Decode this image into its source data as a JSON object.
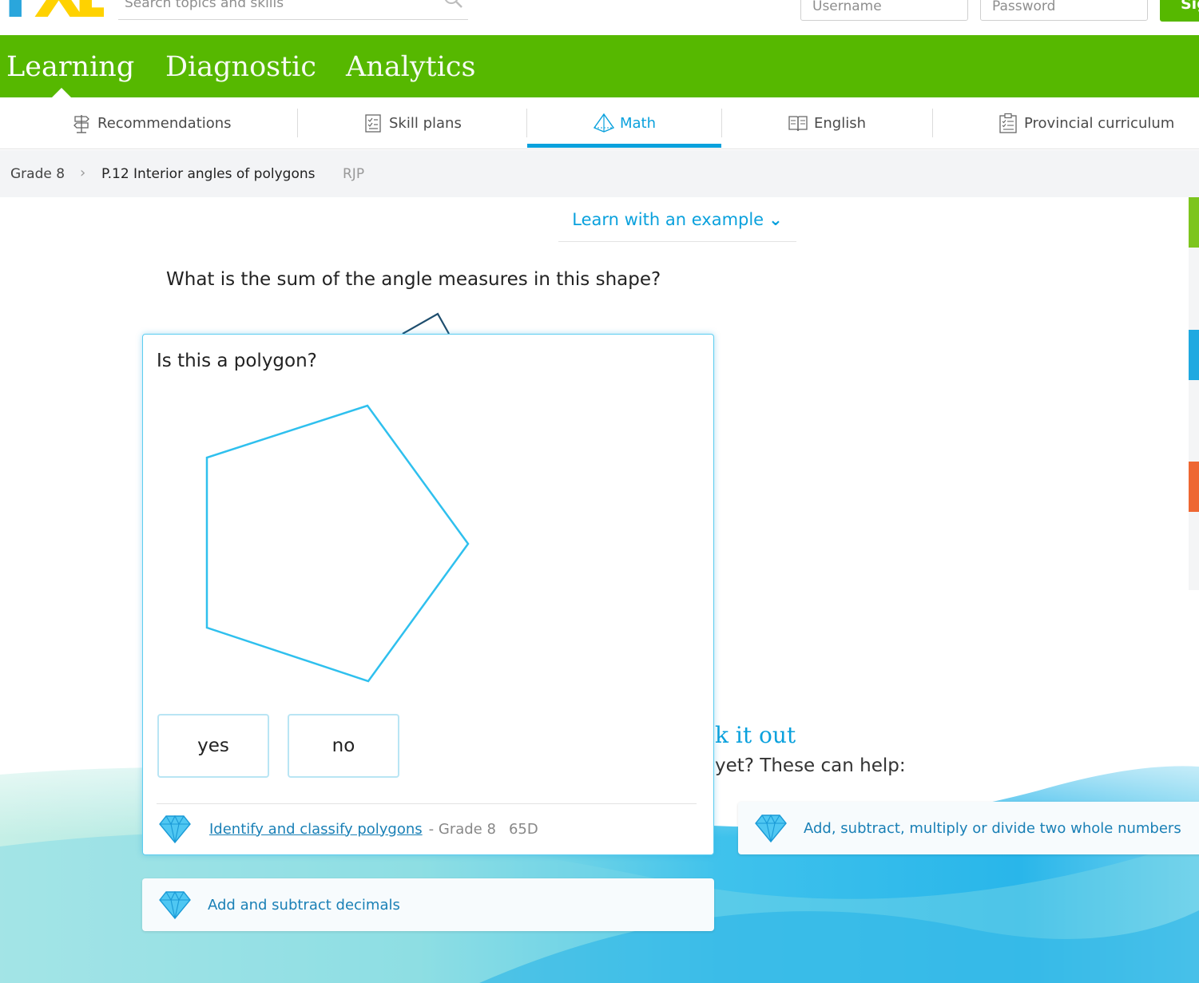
{
  "header": {
    "logo": {
      "letters": [
        "I",
        "X",
        "L"
      ]
    },
    "search": {
      "placeholder": "Search topics and skills",
      "icon": "magnifier-icon"
    },
    "username": {
      "placeholder": "Username"
    },
    "password": {
      "placeholder": "Password"
    },
    "signin_label": "Sig"
  },
  "main_nav": {
    "tabs": [
      {
        "label": "Learning",
        "active": true
      },
      {
        "label": "Diagnostic",
        "active": false
      },
      {
        "label": "Analytics",
        "active": false
      }
    ]
  },
  "sub_nav": {
    "items": [
      {
        "label": "Recommendations",
        "icon": "signpost-icon"
      },
      {
        "label": "Skill plans",
        "icon": "checklist-icon"
      },
      {
        "label": "Math",
        "icon": "pyramid-icon",
        "active": true
      },
      {
        "label": "English",
        "icon": "book-icon"
      },
      {
        "label": "Provincial curriculum",
        "icon": "clipboard-icon"
      }
    ]
  },
  "breadcrumb": {
    "grade": "Grade 8",
    "skill": "P.12 Interior angles of polygons",
    "code": "RJP"
  },
  "learn_example_label": "Learn with an example",
  "question": "What is the sum of the angle measures in this shape?",
  "popup": {
    "title": "Is this a polygon?",
    "answers": [
      "yes",
      "no"
    ],
    "related": {
      "link": "Identify and classify polygons",
      "grade": "- Grade 8",
      "code": "65D"
    }
  },
  "stuck": {
    "title": "k it out",
    "subtitle": "yet? These can help:"
  },
  "help_cards": [
    {
      "label": "Add, subtract, multiply or divide two whole numbers"
    },
    {
      "label": "Add and subtract decimals"
    }
  ],
  "colors": {
    "green": "#56b800",
    "blue": "#0aa1dd",
    "link": "#1a80b6",
    "polygon": "#2fc0ee",
    "strip_green": "#7dc51e",
    "strip_blue": "#1fa9e1",
    "strip_orange": "#ee6732"
  }
}
